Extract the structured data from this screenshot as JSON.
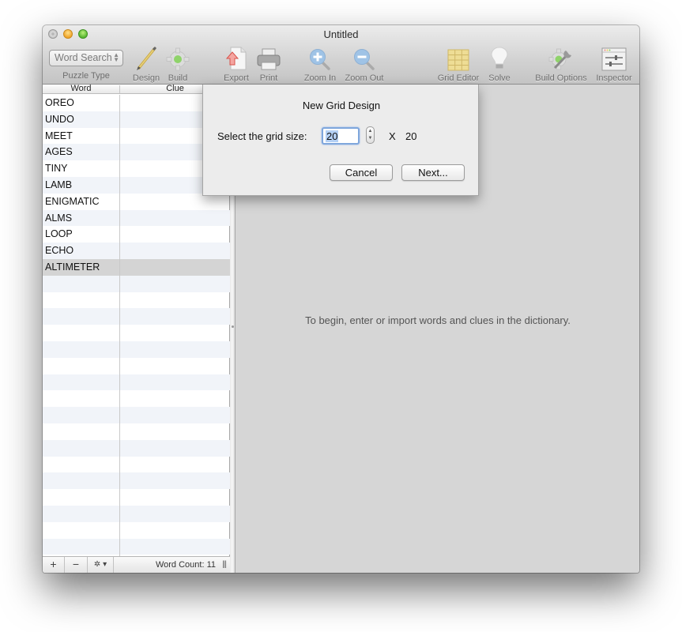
{
  "window": {
    "title": "Untitled"
  },
  "toolbar": {
    "puzzle_type": {
      "selected": "Word Search",
      "label": "Puzzle Type"
    },
    "items": [
      {
        "id": "design",
        "label": "Design",
        "icon": "pencil-icon"
      },
      {
        "id": "build",
        "label": "Build",
        "icon": "gear-icon"
      },
      {
        "id": "export",
        "label": "Export",
        "icon": "export-icon"
      },
      {
        "id": "print",
        "label": "Print",
        "icon": "printer-icon"
      },
      {
        "id": "zoom-in",
        "label": "Zoom In",
        "icon": "zoom-in-icon"
      },
      {
        "id": "zoom-out",
        "label": "Zoom Out",
        "icon": "zoom-out-icon"
      },
      {
        "id": "grid-editor",
        "label": "Grid Editor",
        "icon": "grid-icon"
      },
      {
        "id": "solve",
        "label": "Solve",
        "icon": "lightbulb-icon"
      },
      {
        "id": "build-options",
        "label": "Build Options",
        "icon": "gear-wrench-icon"
      },
      {
        "id": "inspector",
        "label": "Inspector",
        "icon": "sliders-icon"
      }
    ]
  },
  "dictionary": {
    "columns": [
      "Word",
      "Clue"
    ],
    "words": [
      {
        "word": "OREO",
        "clue": ""
      },
      {
        "word": "UNDO",
        "clue": ""
      },
      {
        "word": "MEET",
        "clue": ""
      },
      {
        "word": "AGES",
        "clue": ""
      },
      {
        "word": "TINY",
        "clue": ""
      },
      {
        "word": "LAMB",
        "clue": ""
      },
      {
        "word": "ENIGMATIC",
        "clue": ""
      },
      {
        "word": "ALMS",
        "clue": ""
      },
      {
        "word": "LOOP",
        "clue": ""
      },
      {
        "word": "ECHO",
        "clue": ""
      },
      {
        "word": "ALTIMETER",
        "clue": "",
        "selected": true
      }
    ],
    "add_label": "+",
    "remove_label": "−",
    "action_label": "✲ ▾",
    "word_count_text": "Word Count: 11",
    "resize_glyph": "|||"
  },
  "main": {
    "hint": "To begin, enter or import words and clues in the dictionary."
  },
  "dialog": {
    "title": "New Grid Design",
    "label": "Select the grid size:",
    "size_value": "20",
    "x_label": "X",
    "x_value": "20",
    "cancel_label": "Cancel",
    "next_label": "Next..."
  }
}
